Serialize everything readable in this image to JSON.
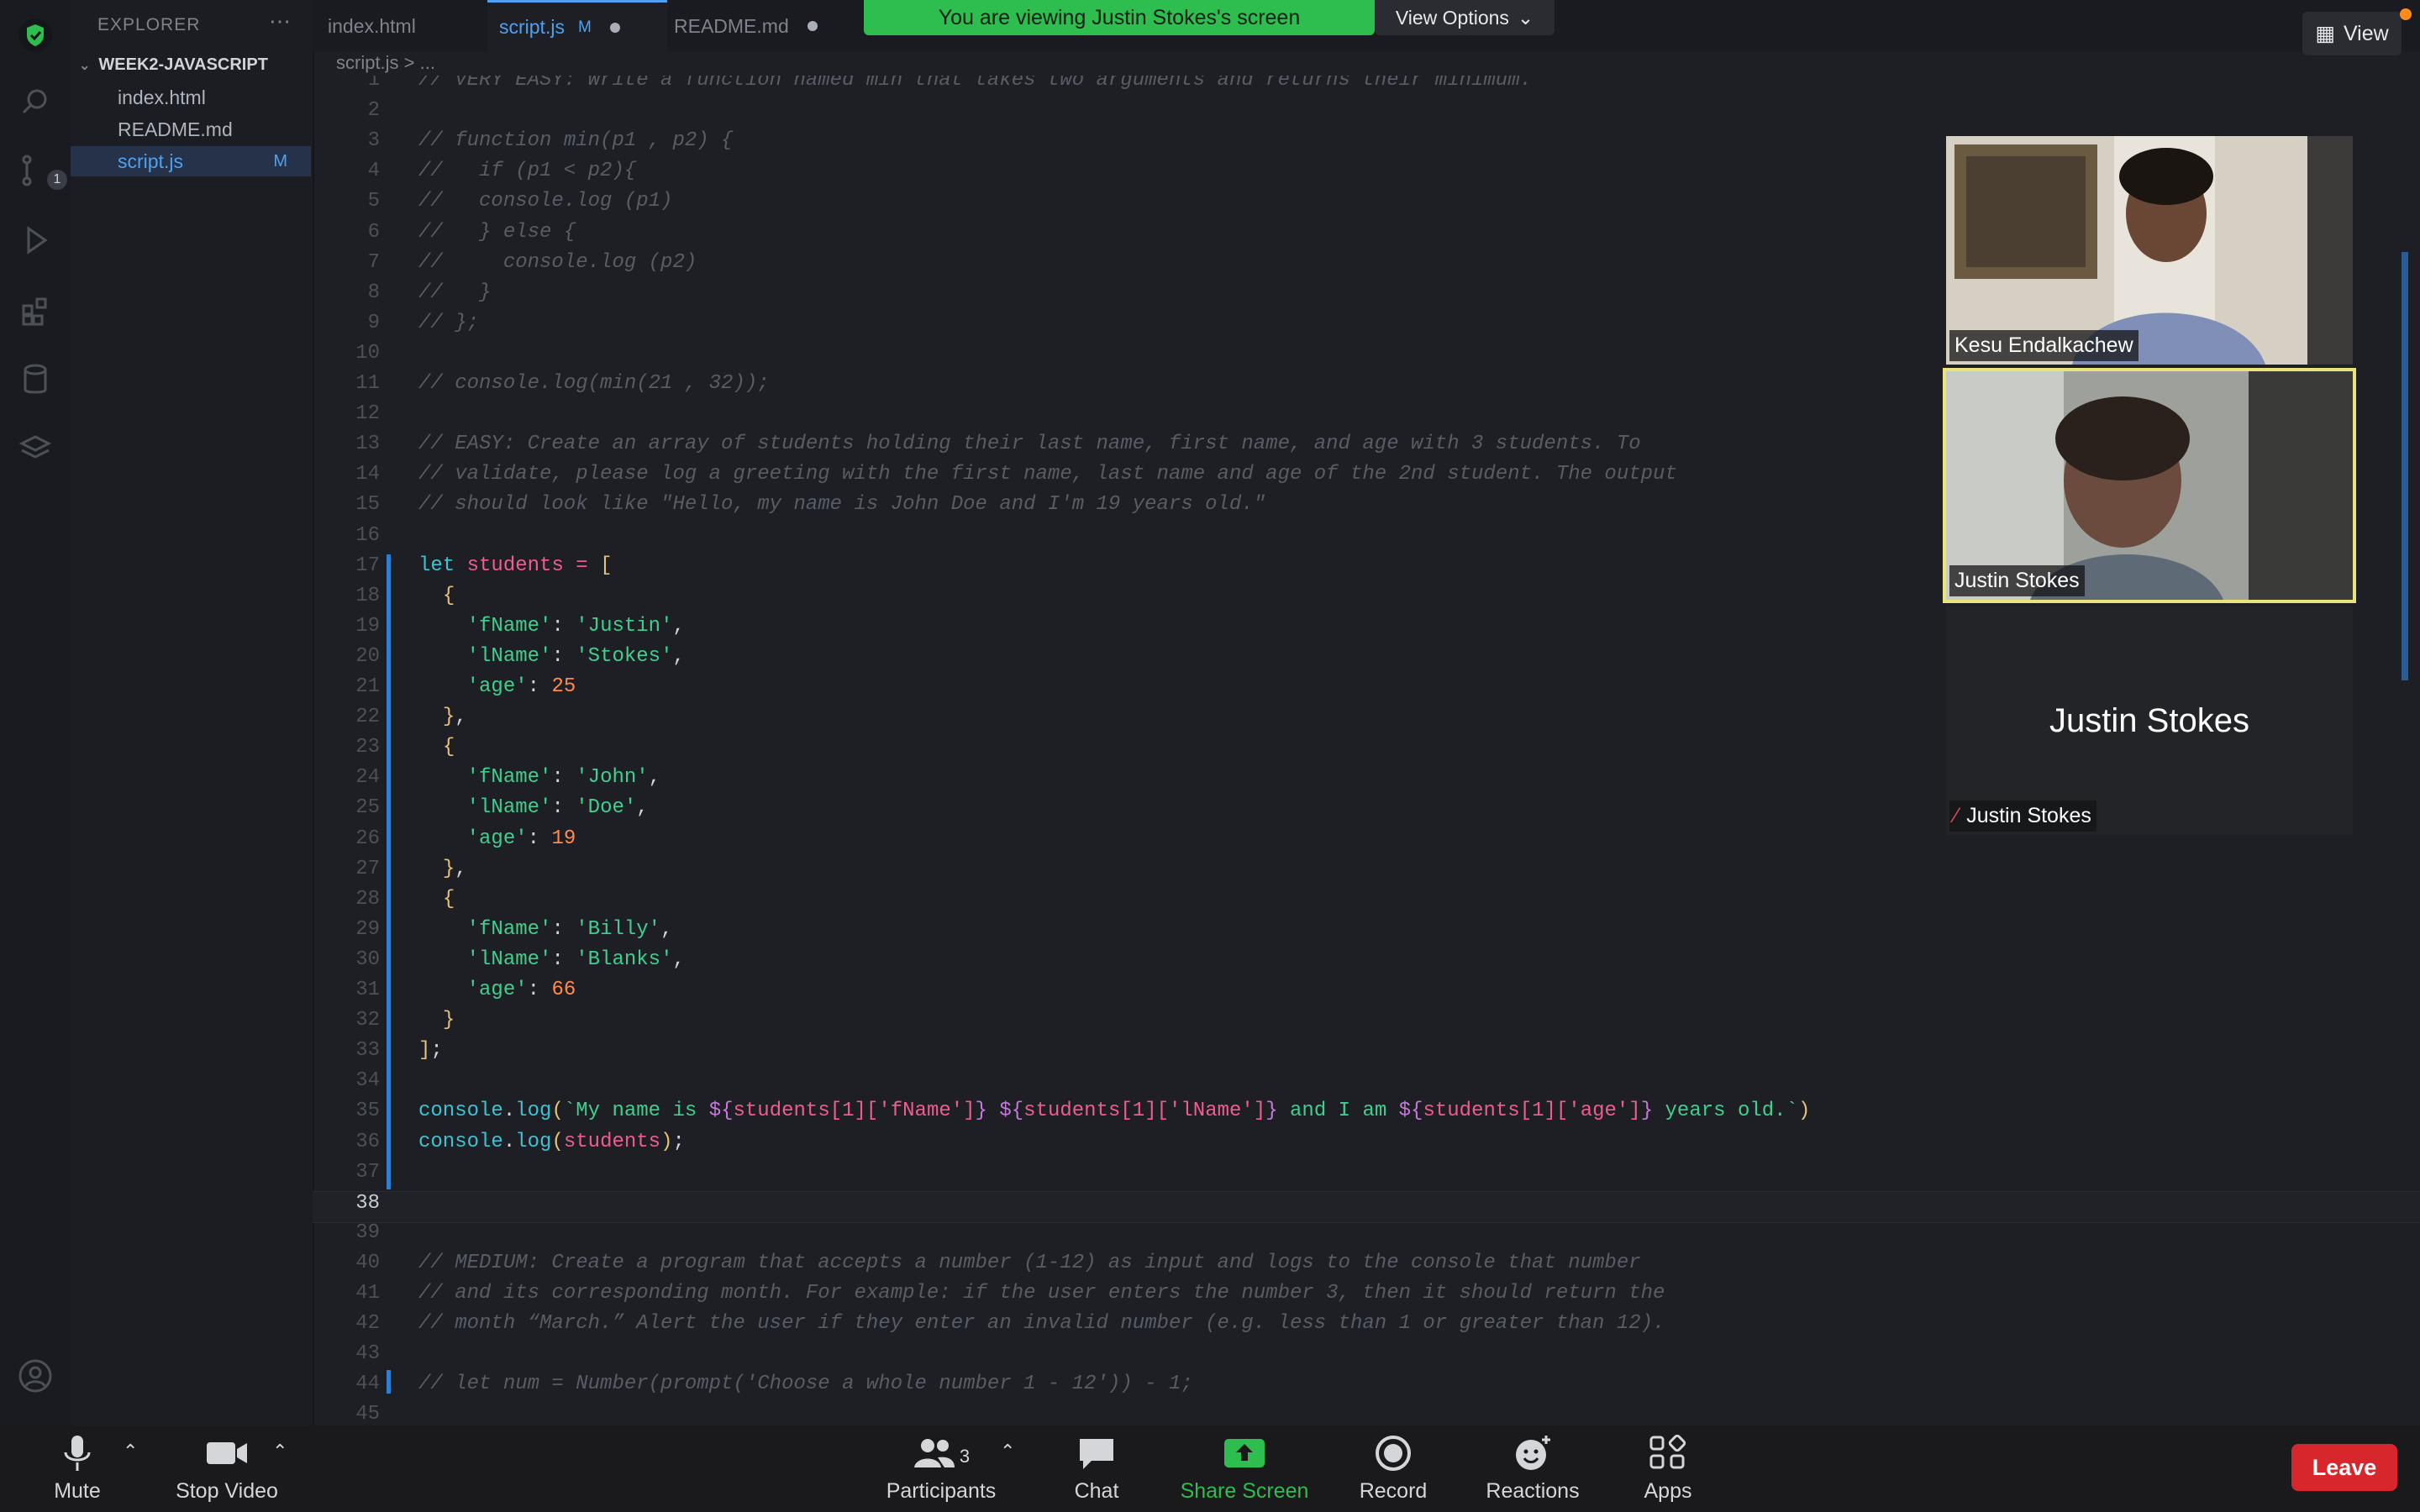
{
  "meeting": {
    "banner_text": "You are viewing Justin Stokes's screen",
    "view_options_label": "View Options",
    "view_label": "View"
  },
  "sidebar": {
    "header": "EXPLORER",
    "folder": "WEEK2-JAVASCRIPT",
    "files": [
      {
        "name": "index.html",
        "status": ""
      },
      {
        "name": "README.md",
        "status": ""
      },
      {
        "name": "script.js",
        "status": "M"
      }
    ],
    "scm_badge": "1"
  },
  "tabs": [
    {
      "label": "index.html",
      "mark": ""
    },
    {
      "label": "script.js",
      "mark": "M"
    },
    {
      "label": "README.md",
      "mark": ""
    }
  ],
  "breadcrumb": "script.js > ...",
  "editor": {
    "lines": [
      {
        "n": "1",
        "t": "// VERY EASY: Write a function named min that takes two arguments and returns their minimum."
      },
      {
        "n": "2",
        "t": ""
      },
      {
        "n": "3",
        "t": "// function min(p1 , p2) {"
      },
      {
        "n": "4",
        "t": "//   if (p1 < p2){"
      },
      {
        "n": "5",
        "t": "//   console.log (p1)"
      },
      {
        "n": "6",
        "t": "//   } else {"
      },
      {
        "n": "7",
        "t": "//     console.log (p2)"
      },
      {
        "n": "8",
        "t": "//   }"
      },
      {
        "n": "9",
        "t": "// };"
      },
      {
        "n": "10",
        "t": ""
      },
      {
        "n": "11",
        "t": "// console.log(min(21 , 32));"
      },
      {
        "n": "12",
        "t": ""
      },
      {
        "n": "13",
        "t": "// EASY: Create an array of students holding their last name, first name, and age with 3 students. To"
      },
      {
        "n": "14",
        "t": "// validate, please log a greeting with the first name, last name and age of the 2nd student. The output"
      },
      {
        "n": "15",
        "t": "// should look like \"Hello, my name is John Doe and I'm 19 years old.\""
      },
      {
        "n": "16",
        "t": ""
      },
      {
        "n": "17",
        "t": "let students = ["
      },
      {
        "n": "18",
        "t": "  {"
      },
      {
        "n": "19",
        "t": "    'fName': 'Justin',"
      },
      {
        "n": "20",
        "t": "    'lName': 'Stokes',"
      },
      {
        "n": "21",
        "t": "    'age': 25"
      },
      {
        "n": "22",
        "t": "  },"
      },
      {
        "n": "23",
        "t": "  {"
      },
      {
        "n": "24",
        "t": "    'fName': 'John',"
      },
      {
        "n": "25",
        "t": "    'lName': 'Doe',"
      },
      {
        "n": "26",
        "t": "    'age': 19"
      },
      {
        "n": "27",
        "t": "  },"
      },
      {
        "n": "28",
        "t": "  {"
      },
      {
        "n": "29",
        "t": "    'fName': 'Billy',"
      },
      {
        "n": "30",
        "t": "    'lName': 'Blanks',"
      },
      {
        "n": "31",
        "t": "    'age': 66"
      },
      {
        "n": "32",
        "t": "  }"
      },
      {
        "n": "33",
        "t": "];"
      },
      {
        "n": "34",
        "t": ""
      },
      {
        "n": "35",
        "t": "console.log(`My name is ${students[1]['fName']} ${students[1]['lName']} and I am ${students[1]['age']} years old.`)"
      },
      {
        "n": "36",
        "t": "console.log(students);"
      },
      {
        "n": "37",
        "t": ""
      },
      {
        "n": "38",
        "t": ""
      },
      {
        "n": "39",
        "t": ""
      },
      {
        "n": "40",
        "t": "// MEDIUM: Create a program that accepts a number (1-12) as input and logs to the console that number"
      },
      {
        "n": "41",
        "t": "// and its corresponding month. For example: if the user enters the number 3, then it should return the"
      },
      {
        "n": "42",
        "t": "// month “March.” Alert the user if they enter an invalid number (e.g. less than 1 or greater than 12)."
      },
      {
        "n": "43",
        "t": ""
      },
      {
        "n": "44",
        "t": "// let num = Number(prompt('Choose a whole number 1 - 12')) - 1;"
      },
      {
        "n": "45",
        "t": ""
      }
    ],
    "current_line": "38"
  },
  "participants": [
    {
      "name": "Kesu Endalkachew",
      "video": true,
      "speaking": false
    },
    {
      "name": "Justin Stokes",
      "video": true,
      "speaking": true
    },
    {
      "name": "Justin Stokes",
      "video": false,
      "speaking": false,
      "muted": true
    }
  ],
  "toolbar": {
    "mute": "Mute",
    "stop_video": "Stop Video",
    "participants": "Participants",
    "participants_count": "3",
    "chat": "Chat",
    "share_screen": "Share Screen",
    "record": "Record",
    "reactions": "Reactions",
    "apps": "Apps",
    "leave": "Leave"
  },
  "colors": {
    "banner": "#2ebd4f",
    "accent": "#4ea1f0",
    "leave": "#d8262d",
    "speaking_outline": "#e8e47a"
  }
}
